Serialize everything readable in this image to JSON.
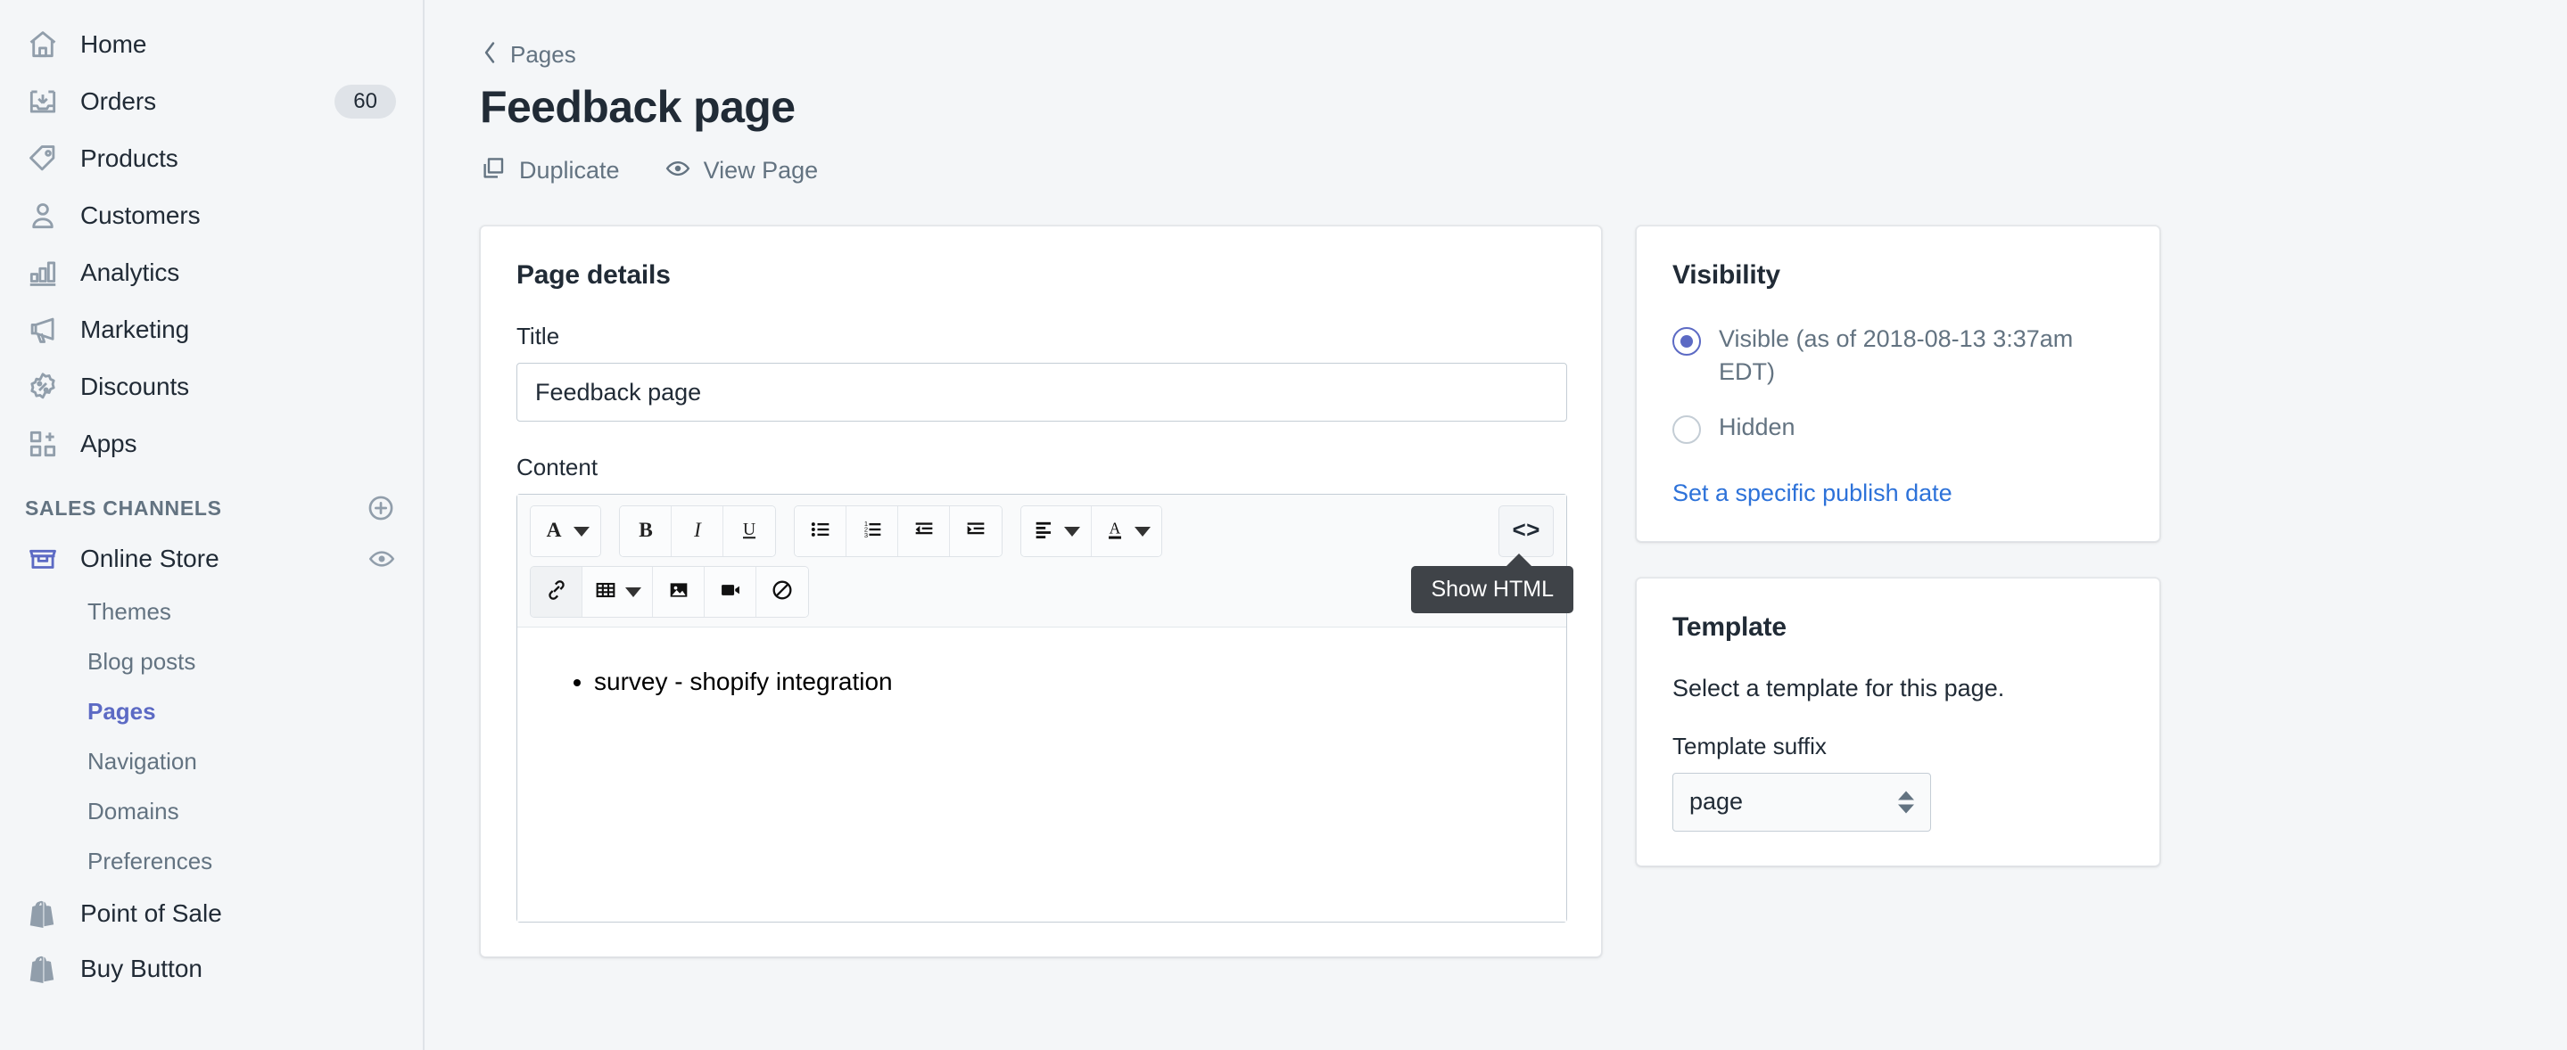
{
  "sidebar": {
    "nav": [
      {
        "label": "Home",
        "icon": "home-icon",
        "badge": null
      },
      {
        "label": "Orders",
        "icon": "orders-icon",
        "badge": "60"
      },
      {
        "label": "Products",
        "icon": "products-tag-icon",
        "badge": null
      },
      {
        "label": "Customers",
        "icon": "customers-icon",
        "badge": null
      },
      {
        "label": "Analytics",
        "icon": "analytics-bars-icon",
        "badge": null
      },
      {
        "label": "Marketing",
        "icon": "marketing-megaphone-icon",
        "badge": null
      },
      {
        "label": "Discounts",
        "icon": "discounts-percent-icon",
        "badge": null
      },
      {
        "label": "Apps",
        "icon": "apps-grid-icon",
        "badge": null
      }
    ],
    "section_title": "SALES CHANNELS",
    "add_channel_icon": "plus-circle-icon",
    "channels": [
      {
        "label": "Online Store",
        "icon": "online-store-icon",
        "eye": "eye-icon"
      },
      {
        "label": "Point of Sale",
        "icon": "shopify-bag-icon",
        "eye": null
      },
      {
        "label": "Buy Button",
        "icon": "shopify-bag-icon",
        "eye": null
      }
    ],
    "online_store_sub": [
      {
        "label": "Themes",
        "active": false
      },
      {
        "label": "Blog posts",
        "active": false
      },
      {
        "label": "Pages",
        "active": true
      },
      {
        "label": "Navigation",
        "active": false
      },
      {
        "label": "Domains",
        "active": false
      },
      {
        "label": "Preferences",
        "active": false
      }
    ]
  },
  "header": {
    "breadcrumb": "Pages",
    "title": "Feedback page",
    "actions": [
      {
        "label": "Duplicate",
        "icon": "duplicate-icon"
      },
      {
        "label": "View Page",
        "icon": "eye-icon"
      }
    ]
  },
  "page_details": {
    "card_title": "Page details",
    "title_label": "Title",
    "title_value": "Feedback page",
    "title_placeholder": "",
    "content_label": "Content",
    "content_items": [
      "survey - shopify integration"
    ]
  },
  "editor_toolbar": {
    "row1": [
      {
        "group": [
          {
            "name": "font-family-button",
            "icon": "serif-A-icon",
            "caret": true
          }
        ]
      },
      {
        "group": [
          {
            "name": "bold-button",
            "icon": "bold-icon",
            "caret": false
          },
          {
            "name": "italic-button",
            "icon": "italic-icon",
            "caret": false
          },
          {
            "name": "underline-button",
            "icon": "underline-icon",
            "caret": false
          }
        ]
      },
      {
        "group": [
          {
            "name": "bullet-list-button",
            "icon": "bullet-list-icon",
            "caret": false
          },
          {
            "name": "numbered-list-button",
            "icon": "numbered-list-icon",
            "caret": false
          },
          {
            "name": "outdent-button",
            "icon": "outdent-icon",
            "caret": false
          },
          {
            "name": "indent-button",
            "icon": "indent-icon",
            "caret": false
          }
        ]
      },
      {
        "group": [
          {
            "name": "align-button",
            "icon": "align-left-icon",
            "caret": true
          },
          {
            "name": "font-color-button",
            "icon": "font-color-icon",
            "caret": true
          }
        ]
      }
    ],
    "row2": [
      {
        "group": [
          {
            "name": "insert-link-button",
            "icon": "link-icon",
            "caret": false,
            "pressed": true
          },
          {
            "name": "insert-table-button",
            "icon": "table-icon",
            "caret": true
          },
          {
            "name": "insert-image-button",
            "icon": "image-icon",
            "caret": false
          },
          {
            "name": "insert-video-button",
            "icon": "video-icon",
            "caret": false
          },
          {
            "name": "clear-formatting-button",
            "icon": "no-formatting-icon",
            "caret": false
          }
        ]
      }
    ],
    "show_html_label": "<>",
    "tooltip": "Show HTML"
  },
  "visibility": {
    "card_title": "Visibility",
    "options": [
      {
        "label": "Visible (as of 2018-08-13 3:37am EDT)",
        "selected": true
      },
      {
        "label": "Hidden",
        "selected": false
      }
    ],
    "publish_date_link": "Set a specific publish date"
  },
  "template": {
    "card_title": "Template",
    "help": "Select a template for this page.",
    "suffix_label": "Template suffix",
    "suffix_value": "page"
  },
  "colors": {
    "accent_indigo": "#5c6ac4",
    "link_blue": "#2d72d9",
    "text_dark": "#212b36",
    "text_muted": "#637381",
    "page_bg": "#f4f6f8",
    "badge_bg": "#dfe3e8",
    "tooltip_bg": "#3f4348"
  }
}
